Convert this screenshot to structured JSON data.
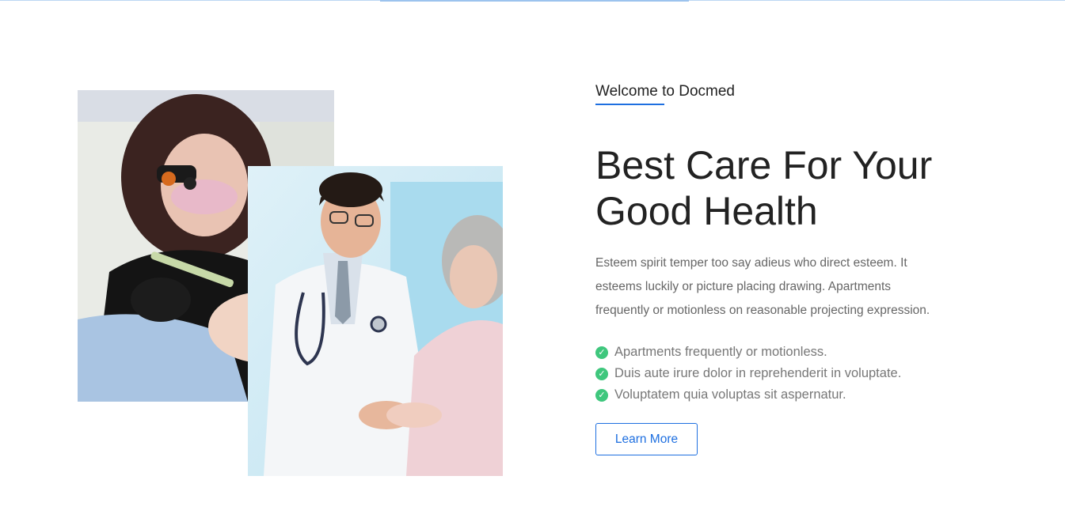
{
  "section": {
    "eyebrow": "Welcome to Docmed",
    "title": "Best Care For Your Good Health",
    "description": "Esteem spirit temper too say adieus who direct esteem. It esteems luckily or picture placing drawing. Apartments frequently or motionless on reasonable projecting expression.",
    "features": [
      "Apartments frequently or motionless.",
      "Duis aute irure dolor in reprehenderit in voluptate.",
      "Voluptatem quia voluptas sit aspernatur."
    ],
    "cta_label": "Learn More"
  },
  "images": {
    "dentist": "dentist-photo",
    "doctor": "doctor-patient-photo"
  },
  "colors": {
    "accent": "#1e6fe0",
    "check": "#3fc77d",
    "heading": "#222222",
    "body_text": "#666666"
  }
}
